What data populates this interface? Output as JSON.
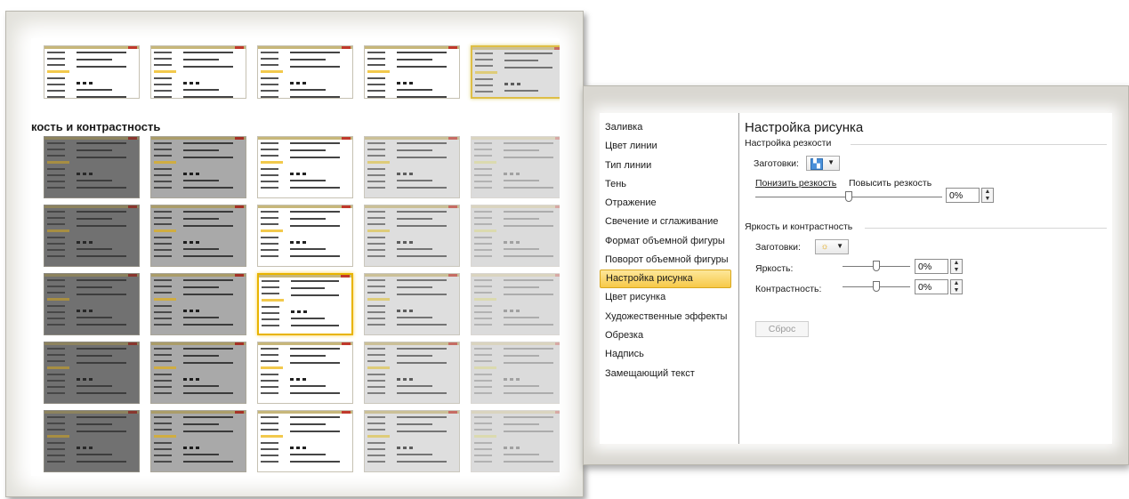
{
  "gallery": {
    "title": "кость и контрастность"
  },
  "dialog": {
    "categories": [
      {
        "label": "Заливка",
        "active": false
      },
      {
        "label": "Цвет линии",
        "active": false
      },
      {
        "label": "Тип линии",
        "active": false
      },
      {
        "label": "Тень",
        "active": false
      },
      {
        "label": "Отражение",
        "active": false
      },
      {
        "label": "Свечение и сглаживание",
        "active": false
      },
      {
        "label": "Формат объемной фигуры",
        "active": false
      },
      {
        "label": "Поворот объемной фигуры",
        "active": false
      },
      {
        "label": "Настройка рисунка",
        "active": true
      },
      {
        "label": "Цвет рисунка",
        "active": false
      },
      {
        "label": "Художественные эффекты",
        "active": false
      },
      {
        "label": "Обрезка",
        "active": false
      },
      {
        "label": "Надпись",
        "active": false
      },
      {
        "label": "Замещающий текст",
        "active": false
      }
    ],
    "content": {
      "title": "Настройка рисунка",
      "sharpness": {
        "section": "Настройка резкости",
        "presets_label": "Заготовки:",
        "soften_label": "Понизить резкость",
        "sharpen_label": "Повысить резкость",
        "value": "0%",
        "slider_position": 0.5
      },
      "brightness_contrast": {
        "section": "Яркость и контрастность",
        "presets_label": "Заготовки:",
        "brightness_label": "Яркость:",
        "brightness_value": "0%",
        "brightness_position": 0.5,
        "contrast_label": "Контрастность:",
        "contrast_value": "0%",
        "contrast_position": 0.5
      },
      "reset_label": "Сброс"
    },
    "accent_color": "#f7c948"
  }
}
